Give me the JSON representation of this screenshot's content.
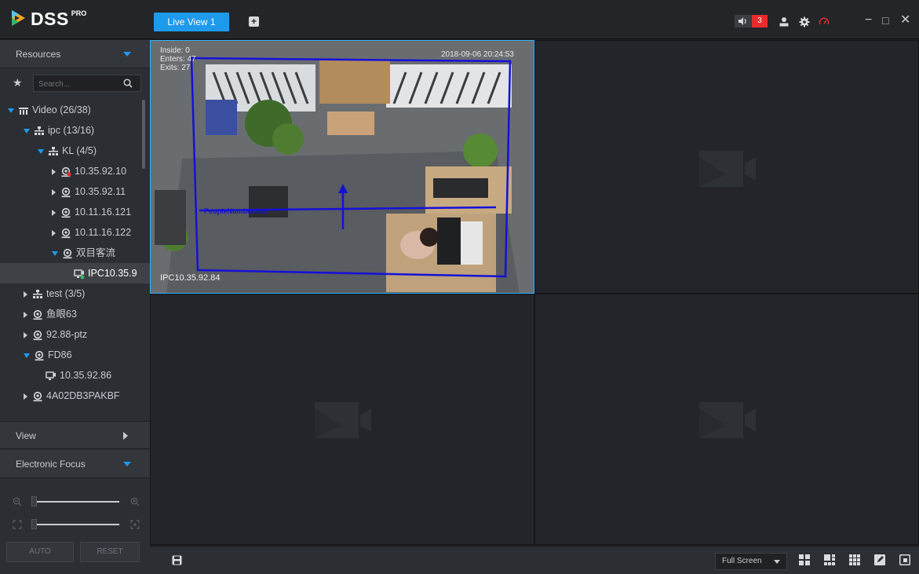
{
  "app": {
    "logo_text": "DSS",
    "logo_sup": "PRO"
  },
  "topbar": {
    "tab_label": "Live View 1",
    "add_tab_symbol": "+",
    "alarm_count": "3",
    "icons": [
      "sound-icon",
      "user-icon",
      "gear-icon",
      "speedometer-icon"
    ],
    "window_controls": [
      "−",
      "□",
      "✕"
    ]
  },
  "sidebar": {
    "resources_label": "Resources",
    "search_placeholder": "Search...",
    "tree": [
      {
        "label": "Video (26/38)",
        "indent": 0,
        "type": "root",
        "expand": "open"
      },
      {
        "label": "ipc (13/16)",
        "indent": 1,
        "type": "org",
        "expand": "open"
      },
      {
        "label": "KL (4/5)",
        "indent": 2,
        "type": "org",
        "expand": "open"
      },
      {
        "label": "10.35.92.10",
        "indent": 3,
        "type": "device-alarm",
        "expand": "closed"
      },
      {
        "label": "10.35.92.11",
        "indent": 3,
        "type": "device",
        "expand": "closed"
      },
      {
        "label": "10.11.16.121",
        "indent": 3,
        "type": "device",
        "expand": "closed"
      },
      {
        "label": "10.11.16.122",
        "indent": 3,
        "type": "device",
        "expand": "closed"
      },
      {
        "label": "双目客流",
        "indent": 3,
        "type": "device",
        "expand": "open"
      },
      {
        "label": "IPC10.35.9",
        "indent": 4,
        "type": "channel-active",
        "expand": "none",
        "selected": true
      },
      {
        "label": "test (3/5)",
        "indent": 1,
        "type": "org",
        "expand": "closed"
      },
      {
        "label": "鱼眼63",
        "indent": 1,
        "type": "device",
        "expand": "closed"
      },
      {
        "label": "92.88-ptz",
        "indent": 1,
        "type": "device",
        "expand": "closed"
      },
      {
        "label": "FD86",
        "indent": 1,
        "type": "device",
        "expand": "open"
      },
      {
        "label": "10.35.92.86",
        "indent": 2,
        "type": "channel",
        "expand": "none"
      },
      {
        "label": "4A02DB3PAKBF",
        "indent": 1,
        "type": "device",
        "expand": "closed"
      }
    ],
    "view_label": "View",
    "efocus_label": "Electronic Focus",
    "auto_label": "AUTO",
    "reset_label": "RESET"
  },
  "video": {
    "cells": [
      {
        "state": "playing"
      },
      {
        "state": "empty"
      },
      {
        "state": "empty"
      },
      {
        "state": "empty"
      }
    ],
    "overlay": {
      "inside": "Inside: 0",
      "enters": "Enters: 47",
      "exits": "Exits: 27",
      "timestamp": "2018-09-06 20:24:53",
      "rule_name": "PeopleNumberStat",
      "camera_name": "IPC10.35.92.84"
    }
  },
  "bottombar": {
    "save_icon": "save-icon",
    "fullscreen_label": "Full Screen",
    "layout_icons": [
      "layout-4-icon",
      "layout-6-icon",
      "layout-9-icon",
      "edit-layout-icon",
      "fit-window-icon"
    ]
  },
  "colors": {
    "accent": "#1e9aed",
    "alarm": "#e82b2b",
    "active_border": "#2fb2ff"
  }
}
